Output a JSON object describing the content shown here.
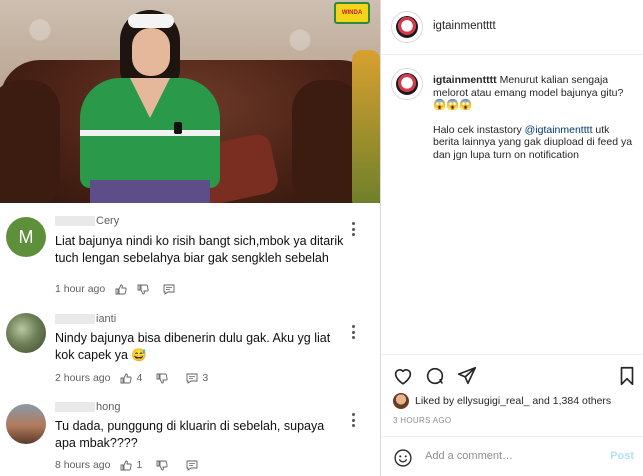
{
  "post": {
    "username": "igtainmentttt",
    "caption_user": "igtainmentttt",
    "caption_line1": "Menurut kalian sengaja melorot atau emang model bajunya gitu?",
    "caption_emoji": "😱😱😱",
    "caption_line2_pre": "Halo cek instastory",
    "caption_mention": "@igtainmentttt",
    "caption_line2_post": "utk berita lainnya yang gak diupload di feed ya dan jgn lupa turn on notification",
    "liked_by_prefix": "Liked by",
    "liked_by_user": "ellysugigi_real_",
    "liked_by_and": "and",
    "liked_by_others": "1,384 others",
    "time_ago": "3 HOURS AGO",
    "comment_placeholder": "Add a comment…",
    "post_label": "Post"
  },
  "video": {
    "channel_logo_text": "WINDA"
  },
  "yt_comments": [
    {
      "avatar_letter": "M",
      "name_suffix": "Cery",
      "text": "Liat bajunya nindi ko risih bangt sich,mbok ya ditarik tuch lengan sebelahya biar gak sengkleh sebelah",
      "time": "1 hour ago",
      "likes": "",
      "replies": ""
    },
    {
      "avatar_letter": "",
      "name_suffix": "ianti",
      "text": "Nindy bajunya bisa dibenerin dulu gak. Aku yg liat kok capek ya 😅",
      "time": "2 hours ago",
      "likes": "4",
      "replies": "3"
    },
    {
      "avatar_letter": "",
      "name_suffix": "hong",
      "text": "Tu dada, punggung di kluarin di sebelah, supaya apa mbak????",
      "time": "8 hours ago",
      "likes": "1",
      "replies": ""
    }
  ],
  "icons": {
    "like": "heart-icon",
    "comment": "comment-bubble-icon",
    "share": "paper-plane-icon",
    "save": "bookmark-icon",
    "emoji": "smiley-icon",
    "thumb_up": "thumb-up-icon",
    "thumb_down": "thumb-down-icon",
    "reply": "reply-icon",
    "more": "more-vertical-icon"
  },
  "colors": {
    "mention": "#00376b",
    "post_disabled": "#b2dffc",
    "muted": "#8e8e8e",
    "avatar_m": "#5e8f3a"
  }
}
